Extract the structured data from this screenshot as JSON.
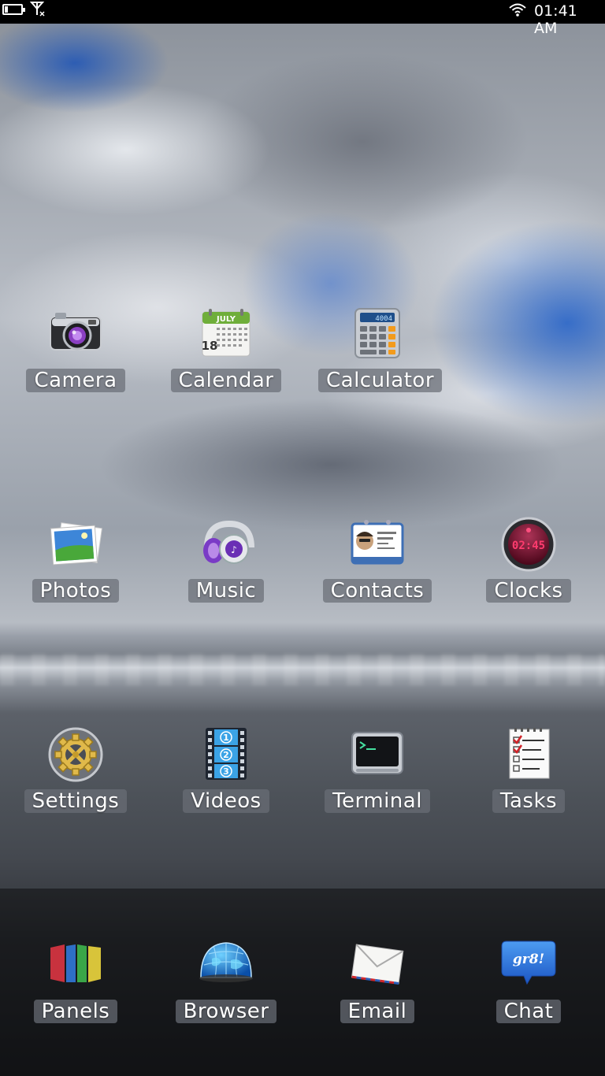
{
  "status_bar": {
    "time": "01:41 AM",
    "icons": [
      "battery-icon",
      "signal-no-service-icon",
      "wifi-icon"
    ]
  },
  "apps": {
    "camera": {
      "label": "Camera",
      "icon": "camera-icon"
    },
    "calendar": {
      "label": "Calendar",
      "icon": "calendar-icon",
      "month": "JULY",
      "day": "18"
    },
    "calculator": {
      "label": "Calculator",
      "icon": "calculator-icon",
      "display": "4004"
    },
    "photos": {
      "label": "Photos",
      "icon": "photos-icon"
    },
    "music": {
      "label": "Music",
      "icon": "headphones-icon"
    },
    "contacts": {
      "label": "Contacts",
      "icon": "contact-card-icon"
    },
    "clocks": {
      "label": "Clocks",
      "icon": "clock-icon",
      "display": "02:45"
    },
    "settings": {
      "label": "Settings",
      "icon": "gear-icon"
    },
    "videos": {
      "label": "Videos",
      "icon": "film-strip-icon"
    },
    "terminal": {
      "label": "Terminal",
      "icon": "terminal-icon"
    },
    "tasks": {
      "label": "Tasks",
      "icon": "checklist-icon"
    }
  },
  "dock": {
    "panels": {
      "label": "Panels",
      "icon": "panels-icon"
    },
    "browser": {
      "label": "Browser",
      "icon": "globe-icon"
    },
    "email": {
      "label": "Email",
      "icon": "envelope-icon"
    },
    "chat": {
      "label": "Chat",
      "icon": "chat-bubble-icon",
      "bubble_text": "gr8!"
    }
  }
}
